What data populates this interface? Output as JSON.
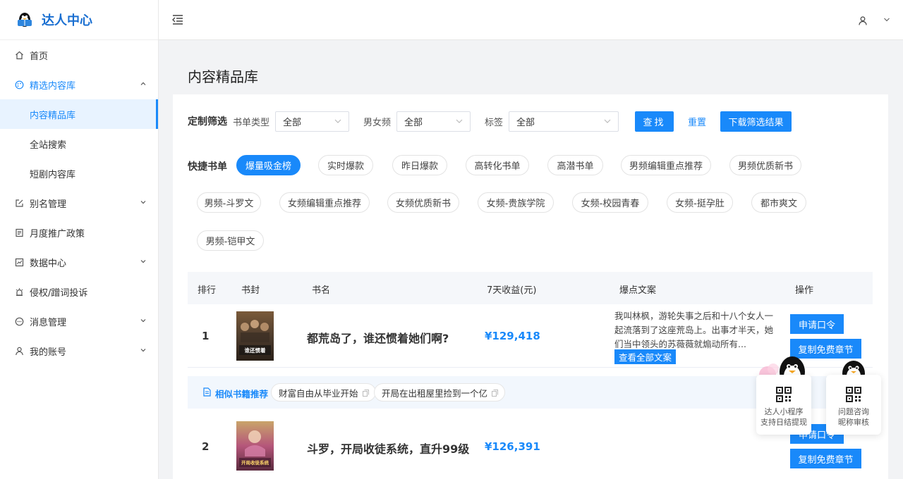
{
  "app": {
    "title": "达人中心"
  },
  "sidebar": {
    "items": [
      {
        "label": "首页",
        "icon": "home-icon"
      },
      {
        "label": "精选内容库",
        "icon": "palette-icon"
      },
      {
        "label": "内容精品库"
      },
      {
        "label": "全站搜索"
      },
      {
        "label": "短剧内容库"
      },
      {
        "label": "别名管理",
        "icon": "edit-icon"
      },
      {
        "label": "月度推广政策",
        "icon": "document-icon"
      },
      {
        "label": "数据中心",
        "icon": "chart-icon"
      },
      {
        "label": "侵权/蹭词投诉",
        "icon": "alarm-icon"
      },
      {
        "label": "消息管理",
        "icon": "message-icon"
      },
      {
        "label": "我的账号",
        "icon": "user-icon"
      }
    ]
  },
  "page": {
    "title": "内容精品库"
  },
  "filters": {
    "title": "定制筛选",
    "booktype_label": "书单类型",
    "booktype_value": "全部",
    "gender_label": "男女频",
    "gender_value": "全部",
    "tag_label": "标签",
    "tag_value": "全部",
    "find": "查找",
    "reset": "重置",
    "download": "下载筛选结果"
  },
  "quick": {
    "title": "快捷书单",
    "pills": [
      "爆量吸金榜",
      "实时爆款",
      "昨日爆款",
      "高转化书单",
      "高潜书单",
      "男频编辑重点推荐",
      "男频优质新书",
      "男频-斗罗文",
      "女频编辑重点推荐",
      "女频优质新书",
      "女频-贵族学院",
      "女频-校园青春",
      "女频-挺孕肚",
      "都市爽文",
      "男频-铠甲文"
    ]
  },
  "table": {
    "headers": [
      "排行",
      "书封",
      "书名",
      "7天收益(元)",
      "爆点文案",
      "操作"
    ],
    "rows": [
      {
        "rank": "1",
        "name": "都荒岛了，谁还惯着她们啊?",
        "income": "¥129,418",
        "blurb": "我叫林枫，游轮失事之后和十八个女人一起流落到了这座荒岛上。出事才半天，她们当中领头的苏薇薇就煽动所有...",
        "view_all": "查看全部文案",
        "apply": "申请口令",
        "copy": "复制免费章节",
        "cover_text": "谁还惯着"
      },
      {
        "rank": "2",
        "name": "斗罗，开局收徒系统，直升99级",
        "income": "¥126,391",
        "apply": "申请口令",
        "copy": "复制免费章节",
        "cover_text": "开局收徒系统"
      }
    ]
  },
  "similar": {
    "title": "相似书籍推荐",
    "books": [
      "财富自由从毕业开始",
      "开局在出租屋里捡到一个亿"
    ]
  },
  "widgets": [
    {
      "line1": "达人小程序",
      "line2": "支持日结提现"
    },
    {
      "line1": "问题咨询",
      "line2": "昵称审核"
    }
  ]
}
